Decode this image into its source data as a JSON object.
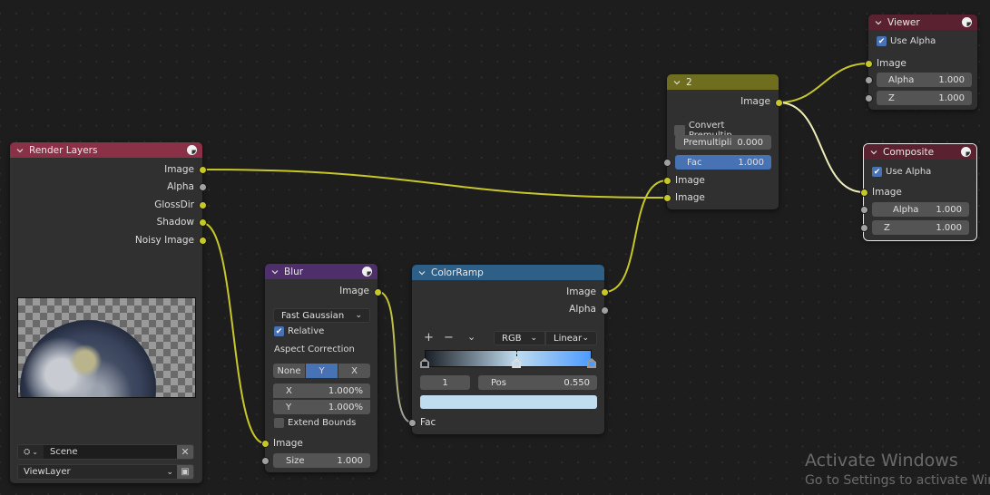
{
  "nodes": {
    "render_layers": {
      "title": "Render Layers",
      "header_color": "#8a3047",
      "outputs": [
        "Image",
        "Alpha",
        "GlossDir",
        "Shadow",
        "Noisy Image"
      ],
      "scene_value": "Scene",
      "view_layer_value": "ViewLayer"
    },
    "blur": {
      "title": "Blur",
      "header_color": "#4e2e6b",
      "output": "Image",
      "filter_type": "Fast Gaussian",
      "relative_label": "Relative",
      "relative_checked": true,
      "aspect_label": "Aspect Correction",
      "aspect_options": [
        "None",
        "Y",
        "X"
      ],
      "aspect_selected": "Y",
      "x_label": "X",
      "x_value": "1.000%",
      "y_label": "Y",
      "y_value": "1.000%",
      "extend_label": "Extend Bounds",
      "extend_checked": false,
      "input_image": "Image",
      "size_label": "Size",
      "size_value": "1.000"
    },
    "colorramp": {
      "title": "ColorRamp",
      "header_color": "#2e5f86",
      "outputs": [
        "Image",
        "Alpha"
      ],
      "add_label": "+",
      "remove_label": "−",
      "color_mode": "RGB",
      "interpolation": "Linear",
      "stops": [
        {
          "pos": 0.0,
          "color": "#1a1f26"
        },
        {
          "pos": 0.55,
          "color": "#c0dcef"
        },
        {
          "pos": 1.0,
          "color": "#4d9bff"
        }
      ],
      "active_index": "1",
      "pos_label": "Pos",
      "pos_value": "0.550",
      "active_color": "#c0dcef",
      "input": "Fac"
    },
    "mix": {
      "title": "2",
      "header_color": "#6f6e1e",
      "output": "Image",
      "convert_label": "Convert Premultip...",
      "convert_checked": false,
      "premul_label": "Premultipli",
      "premul_value": "0.000",
      "fac_label": "Fac",
      "fac_value": "1.000",
      "inputs": [
        "Image",
        "Image"
      ]
    },
    "viewer": {
      "title": "Viewer",
      "header_color": "#5a2131",
      "use_alpha_label": "Use Alpha",
      "use_alpha_checked": true,
      "input_image": "Image",
      "alpha_label": "Alpha",
      "alpha_value": "1.000",
      "z_label": "Z",
      "z_value": "1.000"
    },
    "composite": {
      "title": "Composite",
      "header_color": "#5a2131",
      "use_alpha_label": "Use Alpha",
      "use_alpha_checked": true,
      "input_image": "Image",
      "alpha_label": "Alpha",
      "alpha_value": "1.000",
      "z_label": "Z",
      "z_value": "1.000"
    }
  },
  "watermark": {
    "title": "Activate Windows",
    "subtitle": "Go to Settings to activate Windows."
  },
  "colors": {
    "link_yellow": "#c7c729",
    "link_grey": "#a1a1a1",
    "link_highlight": "#eeeebb",
    "accent_blue": "#4772b3"
  }
}
